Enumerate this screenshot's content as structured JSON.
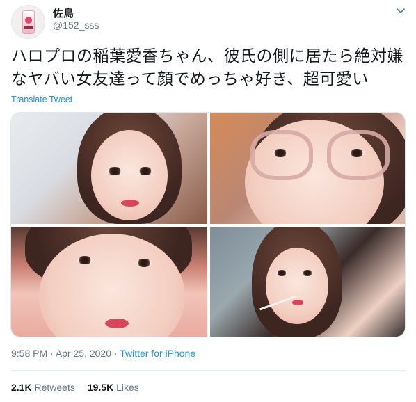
{
  "user": {
    "display_name": "佐鳥",
    "handle": "@152_sss"
  },
  "tweet": {
    "text": "ハロプロの稲葉愛香ちゃん、彼氏の側に居たら絶対嫌なヤバい女友達って顔でめっちゃ好き、超可愛い",
    "translate_label": "Translate Tweet",
    "time": "9:58 PM",
    "separator1": " · ",
    "date": "Apr 25, 2020",
    "separator2": " · ",
    "source": "Twitter for iPhone"
  },
  "stats": {
    "retweets_count": "2.1K",
    "retweets_label": "Retweets",
    "likes_count": "19.5K",
    "likes_label": "Likes"
  },
  "icons": {
    "caret": "chevron-down-icon"
  },
  "colors": {
    "link": "#1b95e0",
    "secondary_text": "#657786",
    "primary_text": "#14171a"
  }
}
